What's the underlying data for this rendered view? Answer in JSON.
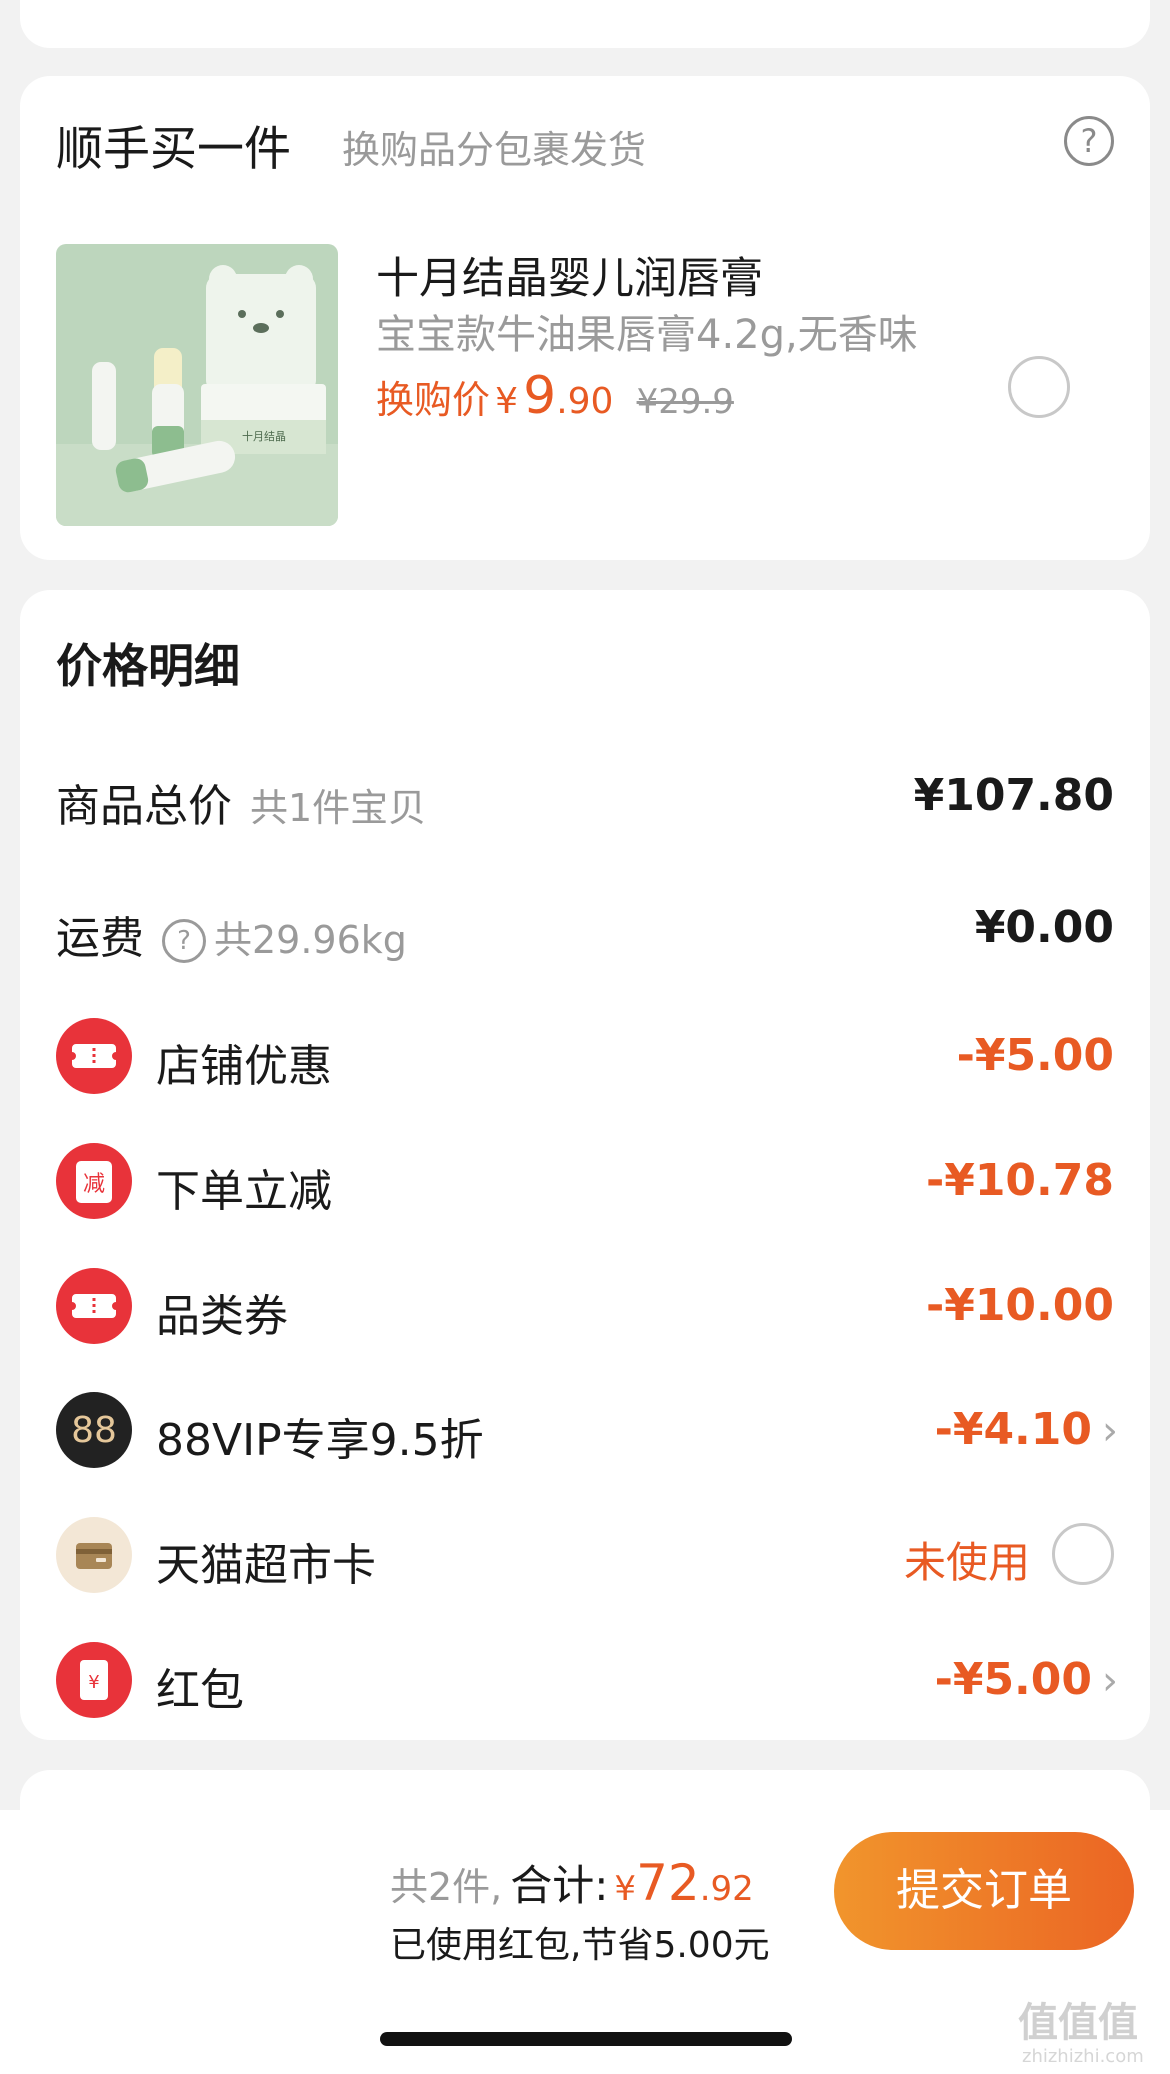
{
  "addon": {
    "title": "顺手买一件",
    "subtitle": "换购品分包裹发货",
    "help_icon": "question-circle-icon",
    "product": {
      "name": "十月结晶婴儿润唇膏",
      "spec": "宝宝款牛油果唇膏4.2g,无香味",
      "price_label": "换购价",
      "currency": "¥",
      "price_int": "9",
      "price_dec": ".90",
      "original_price": "¥29.9",
      "brand_on_box": "十月结晶"
    }
  },
  "price_detail": {
    "title": "价格明细",
    "rows": [
      {
        "label": "商品总价",
        "sub": "共1件宝贝",
        "amount": "¥107.80"
      },
      {
        "label": "运费",
        "sub": "共29.96kg",
        "amount": "¥0.00"
      },
      {
        "label": "店铺优惠",
        "amount": "-¥5.00",
        "icon": "ticket-icon"
      },
      {
        "label": "下单立减",
        "amount": "-¥10.78",
        "icon": "discount-icon",
        "icon_text": "减"
      },
      {
        "label": "品类券",
        "amount": "-¥10.00",
        "icon": "ticket-icon"
      },
      {
        "label": "88VIP专享9.5折",
        "amount": "-¥4.10",
        "icon": "vip88-icon",
        "icon_text": "88"
      },
      {
        "label": "天猫超市卡",
        "amount": "未使用",
        "icon": "card-icon"
      },
      {
        "label": "红包",
        "amount": "-¥5.00",
        "icon": "red-packet-icon",
        "icon_text": "¥"
      }
    ]
  },
  "footer": {
    "count": "共2件,",
    "sum_label": "合计:",
    "currency": "¥",
    "total_int": "72",
    "total_dec": ".92",
    "saved": "已使用红包,节省5.00元",
    "submit": "提交订单",
    "watermark": "值值值",
    "watermark_url": "zhizhizhi.com"
  },
  "colors": {
    "accent": "#e85a23",
    "icon_red": "#e8333a",
    "button_start": "#f1952c",
    "button_end": "#eb6524"
  }
}
